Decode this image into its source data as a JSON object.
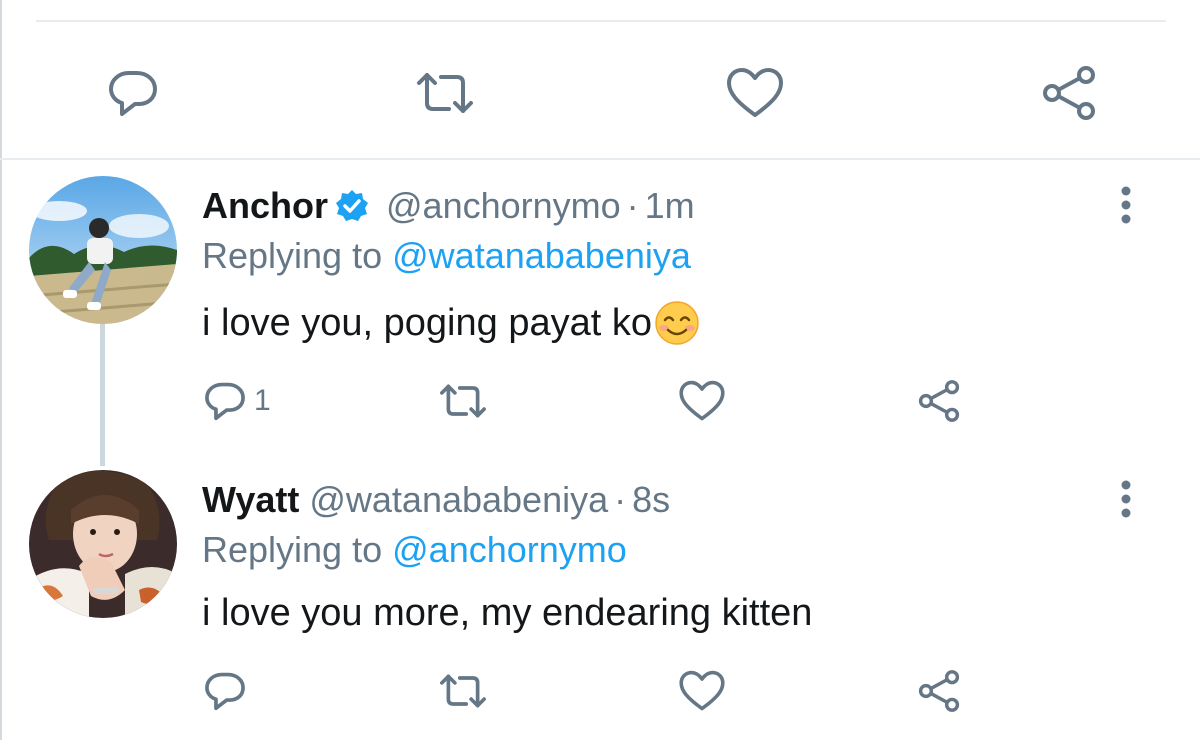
{
  "main_tweet_actions": {
    "icons": [
      "reply-icon",
      "retweet-icon",
      "like-icon",
      "share-icon"
    ]
  },
  "colors": {
    "accent": "#1da1f2",
    "icon": "#657786",
    "text": "#14171a",
    "divider": "#e6ecf0",
    "verified": "#1da1f2"
  },
  "replies": [
    {
      "name": "Anchor",
      "verified": true,
      "handle": "@anchornymo",
      "dot": "·",
      "time": "1m",
      "replying_prefix": "Replying to",
      "replying_to": "@watanababeniya",
      "text": "i love you, poging payat ko",
      "emoji": "smiling-face-with-smiling-eyes",
      "reply_count": "1"
    },
    {
      "name": "Wyatt",
      "verified": false,
      "handle": "@watanababeniya",
      "dot": "·",
      "time": "8s",
      "replying_prefix": "Replying to",
      "replying_to": "@anchornymo",
      "text": "i love you more, my endearing kitten",
      "reply_count": ""
    }
  ]
}
